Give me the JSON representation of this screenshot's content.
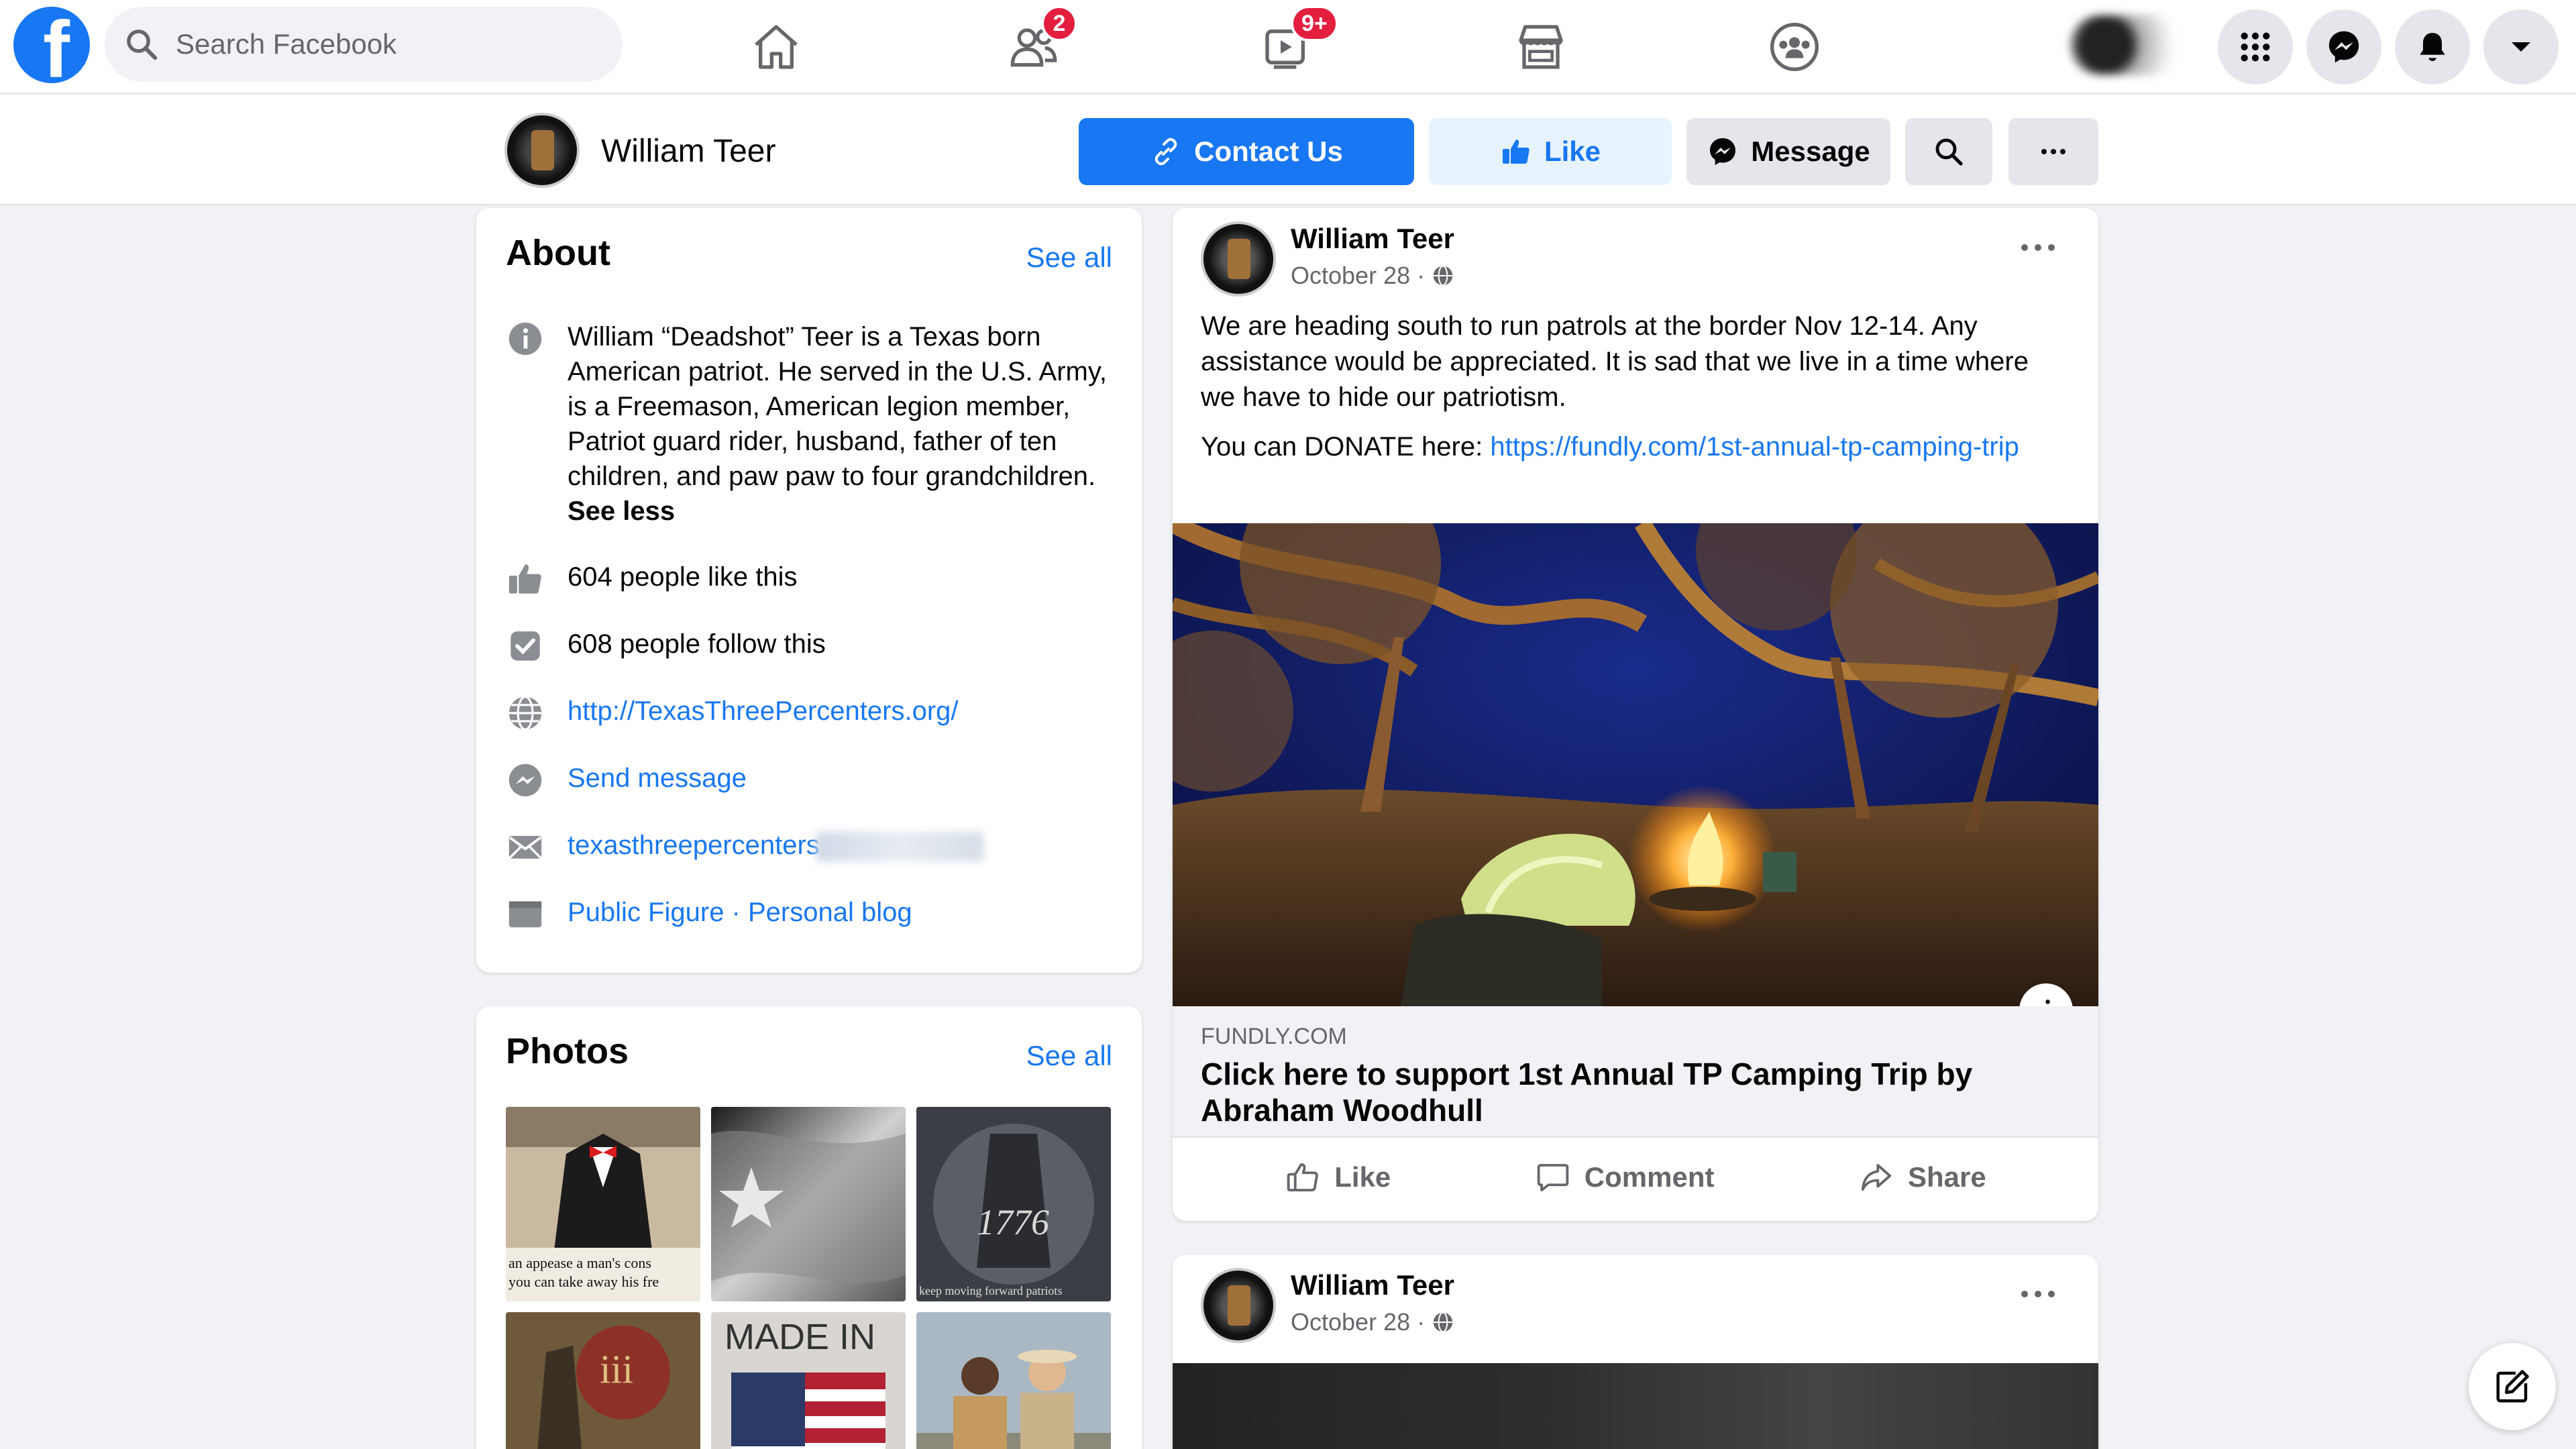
{
  "nav": {
    "search_placeholder": "Search Facebook",
    "logo_letter": "f",
    "friends_badge": "2",
    "watch_badge": "9+"
  },
  "page": {
    "name": "William Teer",
    "contact_label": "Contact Us",
    "like_label": "Like",
    "message_label": "Message"
  },
  "about": {
    "title": "About",
    "see_all": "See all",
    "bio": "William “Deadshot” Teer is a Texas born American patriot. He served in the U.S. Army, is a Freemason, American legion member, Patriot guard rider, husband, father of ten children, and paw paw to four grandchildren.",
    "see_less": "See less",
    "likes": "604 people like this",
    "follows": "608 people follow this",
    "website": "http://TexasThreePercenters.org/",
    "send_message": "Send message",
    "email_visible": "texasthreepercenters",
    "category_1": "Public Figure",
    "category_sep": " · ",
    "category_2": "Personal blog"
  },
  "photos": {
    "title": "Photos",
    "see_all": "See all",
    "captions": [
      "an appease a man's cons",
      "you can take away his fre",
      "MADE IN",
      "1776",
      "keep moving forward patriots"
    ]
  },
  "post1": {
    "author": "William Teer",
    "date": "October 28 ·",
    "text": "We are heading south to run patrols at the border Nov 12-14. Any assistance would be appreciated. It is sad that we live in a time where we have to hide our patriotism.",
    "donate_prefix": "You can DONATE here: ",
    "donate_link": "https://fundly.com/1st-annual-tp-camping-trip",
    "preview_domain": "FUNDLY.COM",
    "preview_title": "Click here to support 1st Annual TP Camping Trip by Abraham Woodhull",
    "like": "Like",
    "comment": "Comment",
    "share": "Share",
    "info_glyph": "i"
  },
  "post2": {
    "author": "William Teer",
    "date": "October 28 ·"
  },
  "colors": {
    "brand": "#1877f2",
    "badge": "#e41e3f",
    "background": "#f0f2f5"
  }
}
